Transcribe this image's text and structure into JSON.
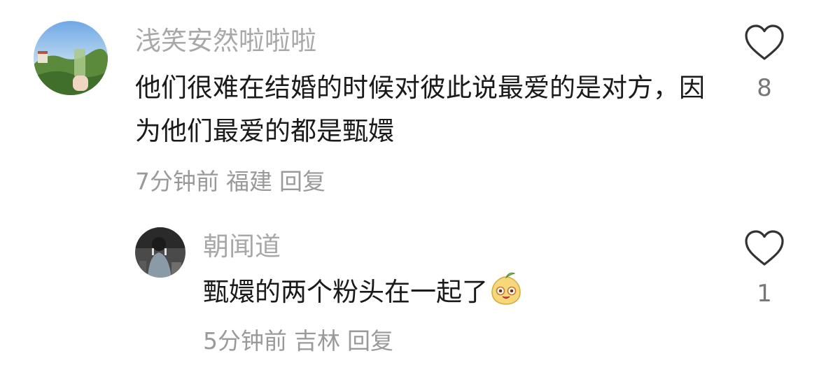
{
  "comments": [
    {
      "username": "浅笑安然啦啦啦",
      "text": "他们很难在结婚的时候对彼此说最爱的是对方，因为他们最爱的都是甄嬛",
      "time": "7分钟前",
      "location": "福建",
      "reply_label": "回复",
      "like_count": "8",
      "like_icon": "heart-outline-icon"
    },
    {
      "username": "朝闻道",
      "text": "甄嬛的两个粉头在一起了",
      "emoji": "smiling-peach-emoji",
      "time": "5分钟前",
      "location": "吉林",
      "reply_label": "回复",
      "like_count": "1",
      "like_icon": "heart-outline-icon"
    }
  ],
  "colors": {
    "username": "#a8a8a8",
    "text": "#1a1a1a",
    "meta": "#9a9a9a",
    "icon": "#333333"
  }
}
